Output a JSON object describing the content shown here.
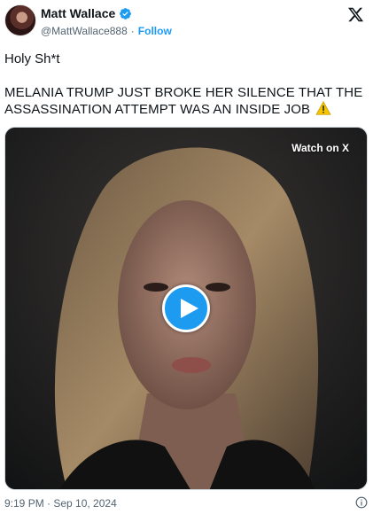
{
  "author": {
    "name": "Matt Wallace",
    "handle": "@MattWallace888",
    "separator": "·",
    "follow_label": "Follow"
  },
  "post": {
    "line1": "Holy Sh*t",
    "line2": "MELANIA TRUMP JUST BROKE HER SILENCE THAT THE ASSASSINATION ATTEMPT WAS AN INSIDE JOB"
  },
  "media": {
    "watch_label": "Watch on X"
  },
  "footer": {
    "timestamp": "9:19 PM · Sep 10, 2024"
  },
  "colors": {
    "accent": "#1d9bf0",
    "text": "#0f1419",
    "muted": "#536471",
    "warning": "#f5c400"
  },
  "icons": [
    "avatar",
    "verified-badge-icon",
    "x-logo-icon",
    "warning-icon",
    "play-icon",
    "info-icon"
  ]
}
